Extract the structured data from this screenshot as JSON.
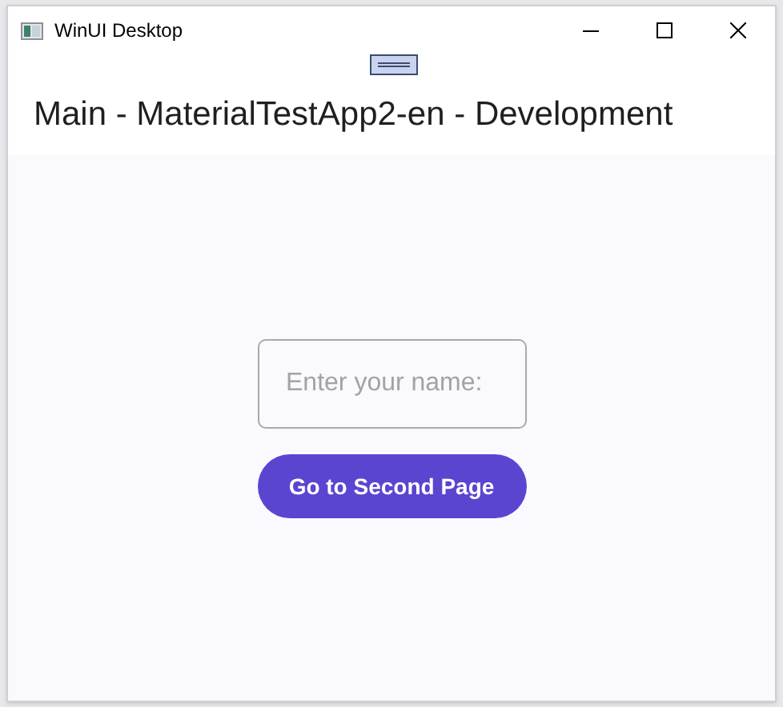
{
  "window": {
    "title": "WinUI Desktop"
  },
  "header": {
    "title": "Main - MaterialTestApp2-en - Development"
  },
  "name_field": {
    "placeholder": "Enter your name:"
  },
  "button": {
    "label": "Go to Second Page"
  }
}
